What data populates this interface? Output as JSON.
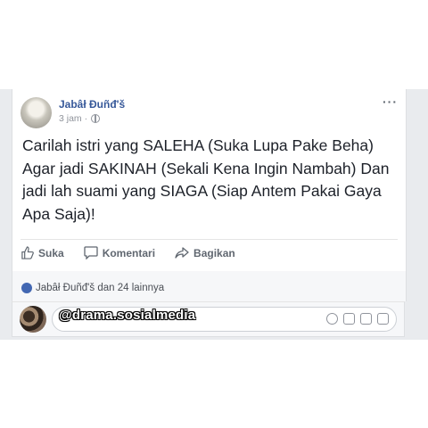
{
  "post": {
    "author": "Jabâł Đuñđ'š",
    "time": "3 jam ·",
    "options_label": "···",
    "text": "Carilah istri yang SALEHA (Suka Lupa Pake Beha) Agar jadi SAKINAH (Sekali Kena Ingin Nambah) Dan jadi lah suami yang SIAGA (Siap Antem Pakai Gaya Apa Saja)!"
  },
  "actions": {
    "like": "Suka",
    "comment": "Komentari",
    "share": "Bagikan"
  },
  "reactions": {
    "text": "Jabâł Đuñđ'š dan 24 lainnya"
  },
  "comment": {
    "placeholder": ""
  },
  "watermark": "@drama.sosialmedia",
  "colors": {
    "feed_bg": "#e9ebee",
    "link": "#365899",
    "like_badge": "#4267b2"
  }
}
